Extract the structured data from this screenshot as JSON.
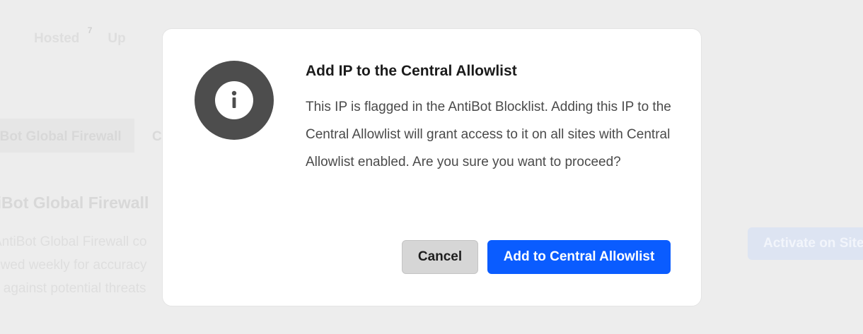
{
  "background": {
    "tabs": [
      {
        "label": "Hosted",
        "count": "7"
      },
      {
        "label": "Up"
      }
    ],
    "subtabs": [
      "tiBot Global Firewall",
      "C"
    ],
    "section_heading": "tiBot Global Firewall",
    "description_lines": [
      " AntiBot Global Firewall co",
      "ewed weekly for accuracy",
      "s against potential threats"
    ],
    "activate_button": "Activate on Site"
  },
  "modal": {
    "icon": "info-icon",
    "title": "Add IP to the Central Allowlist",
    "body": "This IP is flagged in the AntiBot Blocklist. Adding this IP to the Central Allowlist will grant access to it on all sites with Central Allowlist enabled. Are you sure you want to proceed?",
    "cancel_label": "Cancel",
    "confirm_label": "Add to Central Allowlist"
  },
  "colors": {
    "primary": "#0a5cff",
    "icon_bg": "#4d4d4d",
    "overlay_bg": "#ededed"
  }
}
